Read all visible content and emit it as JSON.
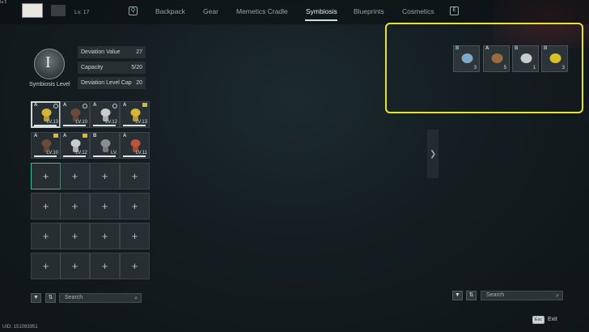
{
  "topbar": {
    "corner": "Ia 5",
    "level_text": "Lv. 17",
    "key_left": "Q",
    "key_right": "E",
    "tabs": [
      "Backpack",
      "Gear",
      "Memetics Cradle",
      "Symbiosis",
      "Blueprints",
      "Cosmetics"
    ],
    "active_tab": "Symbiosis"
  },
  "symbiosis": {
    "level_numeral": "I",
    "level_label": "Symbiosis Level",
    "stats": [
      {
        "label": "Deviation Value",
        "value": "27"
      },
      {
        "label": "Capacity",
        "value": "5/20"
      },
      {
        "label": "Deviation Level Cap",
        "value": "20"
      }
    ]
  },
  "grid": {
    "filled": [
      {
        "rank": "A",
        "level": "LV.13",
        "mark": "check",
        "color": "#d6b53a",
        "selected": true
      },
      {
        "rank": "A",
        "level": "LV.10",
        "mark": "check",
        "color": "#6b4a3a",
        "selected": false
      },
      {
        "rank": "A",
        "level": "LV.12",
        "mark": "check",
        "color": "#c9cccd",
        "selected": false
      },
      {
        "rank": "A",
        "level": "LV.13",
        "mark": "star",
        "color": "#d6b53a",
        "selected": false
      },
      {
        "rank": "A",
        "level": "LV.10",
        "mark": "star",
        "color": "#6b4a3a",
        "selected": false
      },
      {
        "rank": "A",
        "level": "LV.12",
        "mark": "star",
        "color": "#c9cccd",
        "selected": false
      },
      {
        "rank": "B",
        "level": "LV.",
        "mark": "",
        "color": "#8a8e90",
        "selected": false
      },
      {
        "rank": "A",
        "level": "LV.11",
        "mark": "",
        "color": "#b8553a",
        "selected": false
      }
    ],
    "empty_plus": "+"
  },
  "bottom_left": {
    "filter_icon": "funnel-icon",
    "sort_icon": "sort-icon",
    "search_placeholder": "Search"
  },
  "uid": "UID: 151093951",
  "right_panel": {
    "items": [
      {
        "rank": "B",
        "count": "3",
        "color": "#7fa9c9"
      },
      {
        "rank": "A",
        "count": "5",
        "color": "#9a6a45"
      },
      {
        "rank": "B",
        "count": "1",
        "color": "#c9cccd"
      },
      {
        "rank": "B",
        "count": "3",
        "color": "#d8c22a"
      }
    ],
    "search_placeholder": "Search"
  },
  "footer": {
    "esc_key": "Esc",
    "esc_label": "Exit"
  }
}
